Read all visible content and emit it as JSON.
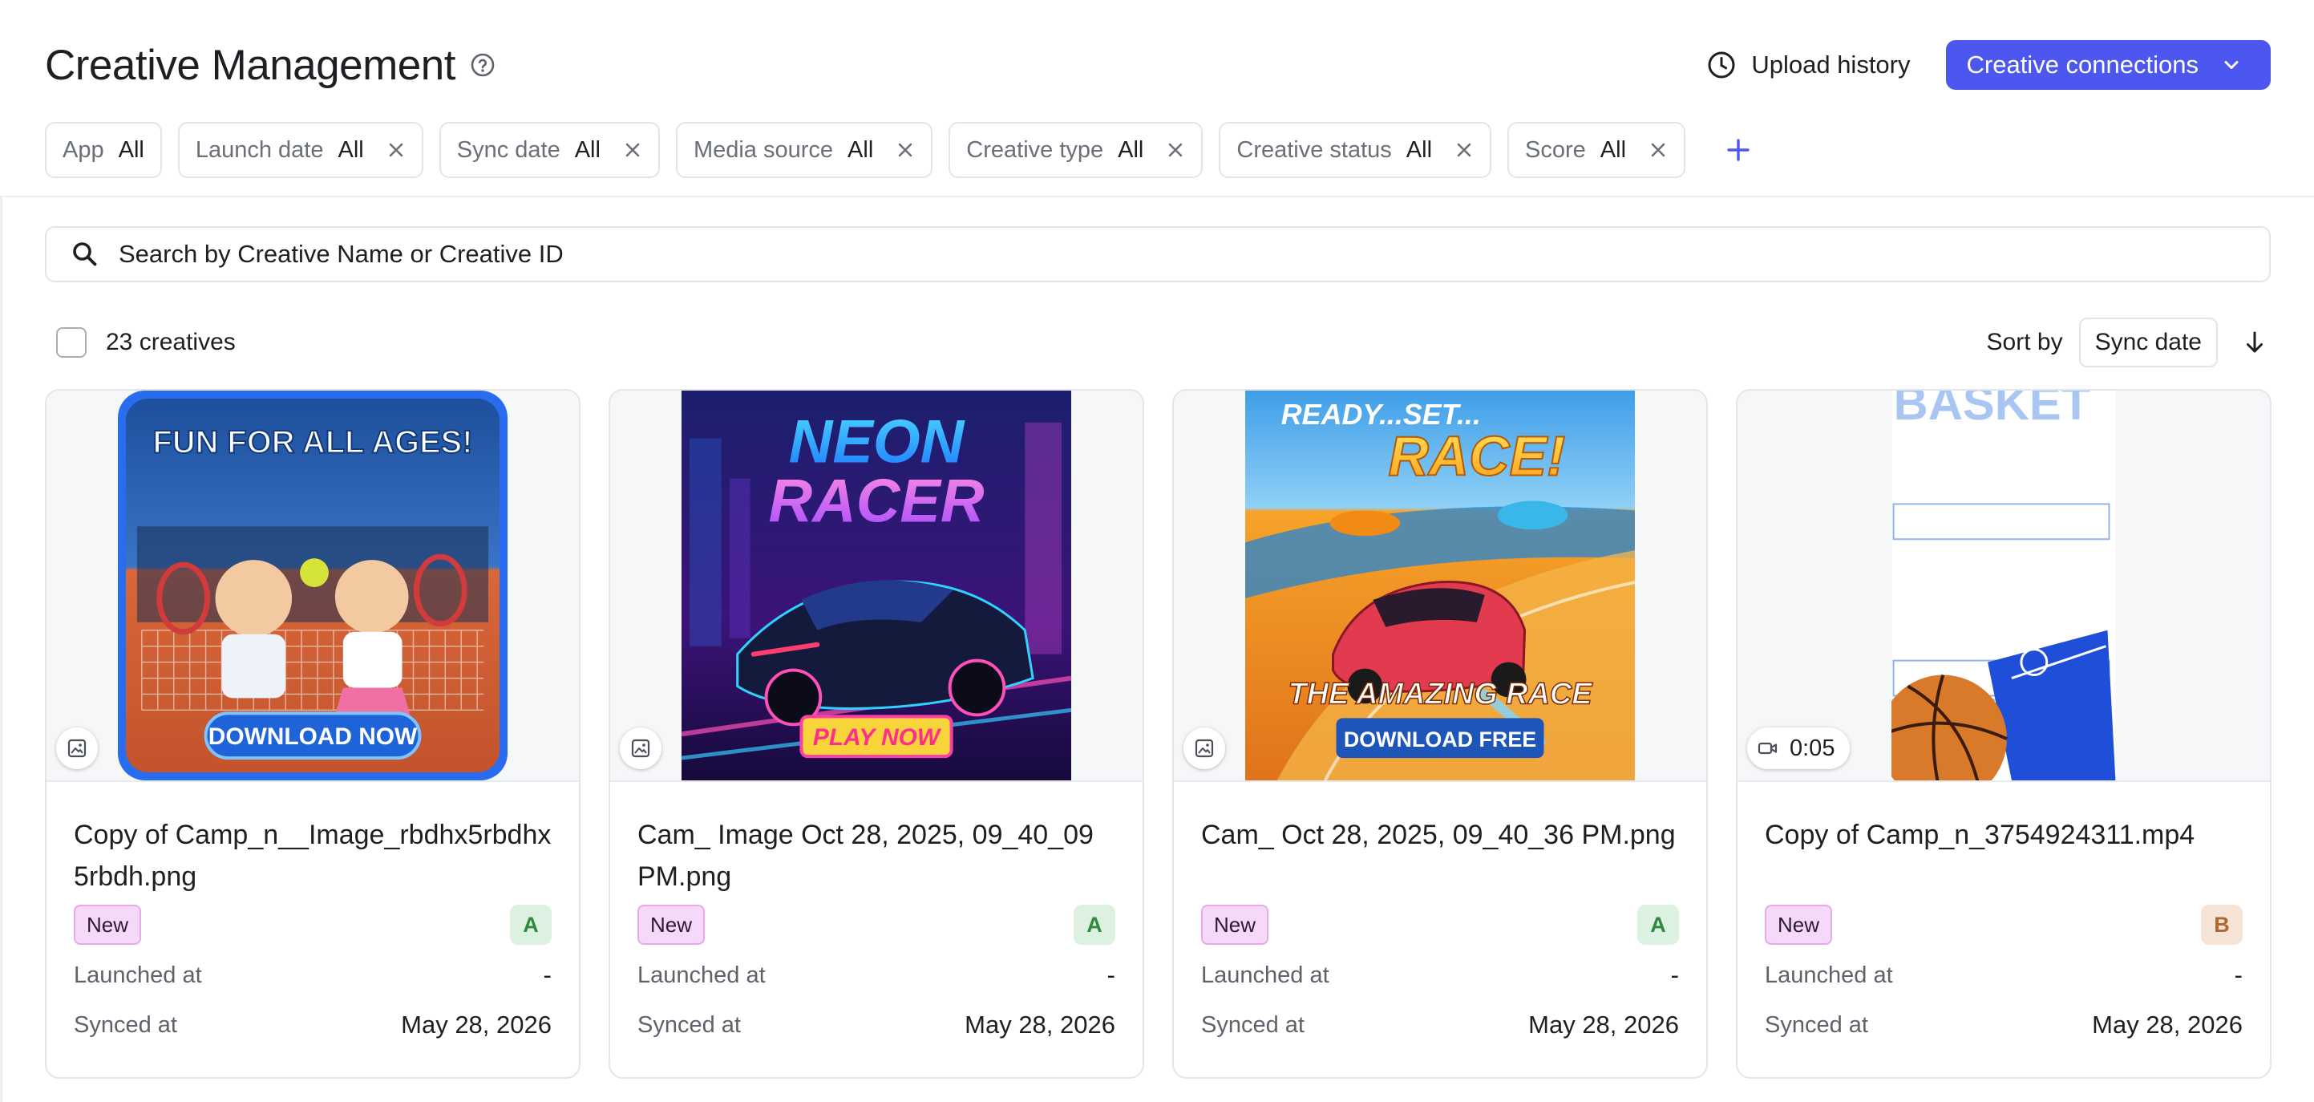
{
  "header": {
    "title": "Creative Management",
    "upload_history": "Upload history",
    "creative_connections": "Creative connections"
  },
  "filters": [
    {
      "label": "App",
      "value": "All",
      "removable": false
    },
    {
      "label": "Launch date",
      "value": "All",
      "removable": true
    },
    {
      "label": "Sync date",
      "value": "All",
      "removable": true
    },
    {
      "label": "Media source",
      "value": "All",
      "removable": true
    },
    {
      "label": "Creative type",
      "value": "All",
      "removable": true
    },
    {
      "label": "Creative status",
      "value": "All",
      "removable": true
    },
    {
      "label": "Score",
      "value": "All",
      "removable": true
    }
  ],
  "search": {
    "placeholder": "Search by Creative Name or Creative ID"
  },
  "toolbar": {
    "count": "23 creatives",
    "sort_label": "Sort by",
    "sort_value": "Sync date"
  },
  "labels": {
    "launched": "Launched at",
    "synced": "Synced at"
  },
  "colors": {
    "accent": "#4b57ef",
    "score_a_bg": "#dcf1df",
    "score_a_fg": "#2f8a3e",
    "score_b_bg": "#f6e4d6",
    "score_b_fg": "#b0662c"
  },
  "cards": [
    {
      "name": "Copy of Camp_n__Image_rbdhx5rbdhx5rbdh.png",
      "status": "New",
      "score": "A",
      "launched": "-",
      "synced": "May 28, 2026",
      "media": "image",
      "duration": "",
      "art": {
        "lines": [
          "FUN FOR ALL AGES!",
          "DOWNLOAD NOW"
        ]
      }
    },
    {
      "name": "Cam_ Image Oct 28, 2025, 09_40_09 PM.png",
      "status": "New",
      "score": "A",
      "launched": "-",
      "synced": "May 28, 2026",
      "media": "image",
      "duration": "",
      "art": {
        "lines": [
          "NEON",
          "RACER",
          "PLAY NOW"
        ]
      }
    },
    {
      "name": "Cam_ Oct 28, 2025, 09_40_36 PM.png",
      "status": "New",
      "score": "A",
      "launched": "-",
      "synced": "May 28, 2026",
      "media": "image",
      "duration": "",
      "art": {
        "lines": [
          "READY...SET...",
          "RACE!",
          "THE AMAZING RACE",
          "DOWNLOAD FREE"
        ]
      }
    },
    {
      "name": "Copy of Camp_n_3754924311.mp4",
      "status": "New",
      "score": "B",
      "launched": "-",
      "synced": "May 28, 2026",
      "media": "video",
      "duration": "0:05",
      "art": {
        "lines": [
          "BASKET"
        ]
      }
    }
  ]
}
